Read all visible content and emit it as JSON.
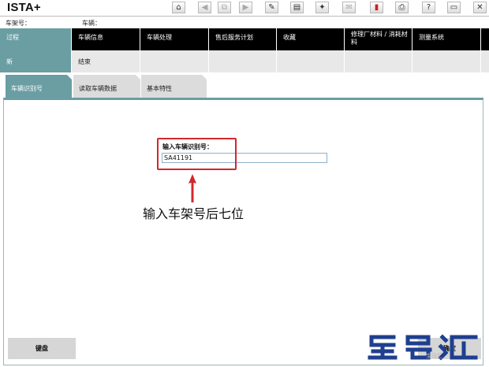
{
  "app": {
    "title": "ISTA+"
  },
  "toolbar": {
    "buttons": [
      {
        "icon": "home-icon",
        "glyph": "⌂"
      },
      {
        "icon": "back-icon",
        "glyph": "◀"
      },
      {
        "icon": "copy-icon",
        "glyph": "⧉"
      },
      {
        "icon": "forward-icon",
        "glyph": "▶"
      },
      {
        "icon": "wrench-icon",
        "glyph": "✎"
      },
      {
        "icon": "chart-icon",
        "glyph": "▤"
      },
      {
        "icon": "tools-icon",
        "glyph": "✦"
      },
      {
        "icon": "mail-icon",
        "glyph": "✉"
      },
      {
        "icon": "battery-icon",
        "glyph": "▮"
      },
      {
        "icon": "print-icon",
        "glyph": "⎙"
      },
      {
        "icon": "help-icon",
        "glyph": "?"
      },
      {
        "icon": "minimize-icon",
        "glyph": "▭"
      },
      {
        "icon": "close-icon",
        "glyph": "✕"
      }
    ]
  },
  "info": {
    "chassis_label": "车架号：",
    "vehicle_label": "车辆："
  },
  "main_nav": [
    {
      "label": "过程",
      "active": true
    },
    {
      "label": "车辆信息"
    },
    {
      "label": "车辆处理"
    },
    {
      "label": "售后服务计划"
    },
    {
      "label": "收藏"
    },
    {
      "label": "修理厂材料 / 消耗材料"
    },
    {
      "label": "测量系统"
    }
  ],
  "sub_nav": [
    {
      "label": "新",
      "active": true
    },
    {
      "label": "结束"
    }
  ],
  "tabs": [
    {
      "label": "车辆识别号",
      "active": true
    },
    {
      "label": "读取车辆数据"
    },
    {
      "label": "基本特性"
    }
  ],
  "form": {
    "vin_label": "输入车辆识别号：",
    "vin_value": "SA41191"
  },
  "annotation": {
    "text": "输入车架号后七位",
    "color": "#d0282e"
  },
  "footer": {
    "keyboard_label": "键盘",
    "confirm_label": "确定",
    "watermark_brand": "宝马汇"
  },
  "colors": {
    "accent": "#6a9ea3",
    "nav_bg": "#000000",
    "highlight": "#d0282e"
  }
}
